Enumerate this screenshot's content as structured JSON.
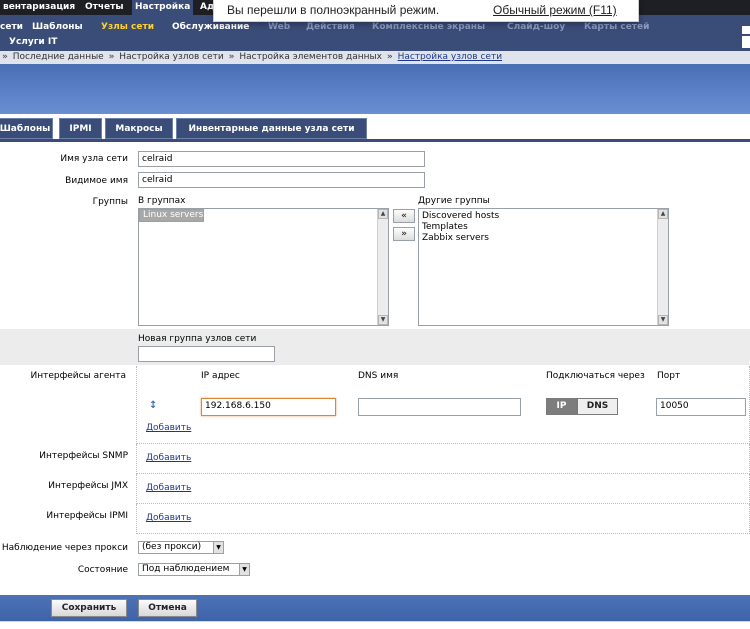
{
  "nav_top": {
    "items": [
      "вентаризация",
      "Отчеты",
      "Настройка",
      "Ад"
    ]
  },
  "nav_sub": {
    "items": [
      "сети",
      "Шаблоны",
      "Узлы сети",
      "Обслуживание",
      "Web",
      "Действия",
      "Комплексные экраны",
      "Слайд-шоу",
      "Карты сетей"
    ],
    "second_row": "Услуги IT"
  },
  "fullscreen_notice": {
    "text": "Вы перешли в полноэкранный режим.",
    "exit_link": "Обычный режим (F11)"
  },
  "breadcrumb": {
    "items": [
      "Последние данные",
      "Настройка узлов сети",
      "Настройка элементов данных"
    ],
    "current": "Настройка узлов сети",
    "separator": "»"
  },
  "tabs": [
    "Шаблоны",
    "IPMI",
    "Макросы",
    "Инвентарные данные узла сети"
  ],
  "form": {
    "host_name_label": "Имя узла сети",
    "host_name_value": "celraid",
    "visible_name_label": "Видимое имя",
    "visible_name_value": "celraid",
    "groups_label": "Группы",
    "in_groups_label": "В группах",
    "in_groups": [
      "Linux servers"
    ],
    "other_groups_label": "Другие группы",
    "other_groups": [
      "Discovered hosts",
      "Templates",
      "Zabbix servers"
    ],
    "move_left": "«",
    "move_right": "»",
    "new_group_label": "Новая группа узлов сети",
    "new_group_value": "",
    "agent_interfaces_label": "Интерфейсы агента",
    "col_ip": "IP адрес",
    "col_dns": "DNS имя",
    "col_connect": "Подключаться через",
    "col_port": "Порт",
    "ip_value": "192.168.6.150",
    "dns_value": "",
    "connect_ip": "IP",
    "connect_dns": "DNS",
    "port_value": "10050",
    "add": "Добавить",
    "snmp_label": "Интерфейсы SNMP",
    "jmx_label": "Интерфейсы JMX",
    "ipmi_label": "Интерфейсы IPMI",
    "proxy_label": "Наблюдение через прокси",
    "proxy_value": "(без прокси)",
    "status_label": "Состояние",
    "status_value": "Под наблюдением"
  },
  "footer": {
    "save": "Сохранить",
    "cancel": "Отмена"
  }
}
